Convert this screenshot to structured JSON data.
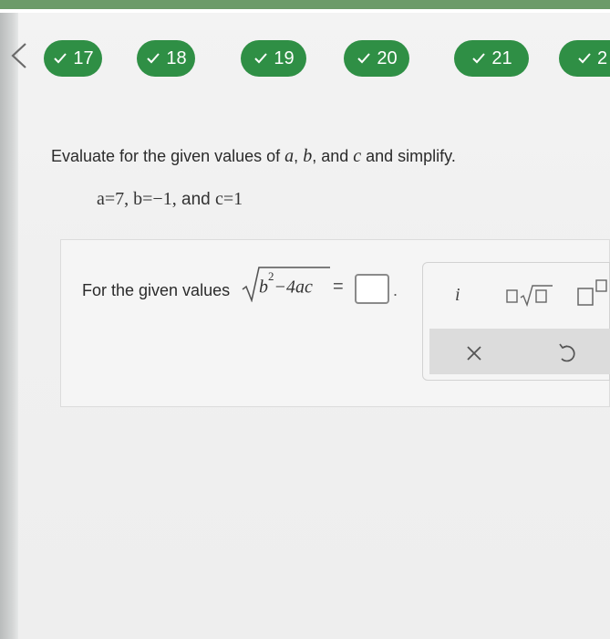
{
  "navigation": {
    "questions": [
      {
        "number": "17",
        "status": "correct"
      },
      {
        "number": "18",
        "status": "correct"
      },
      {
        "number": "19",
        "status": "correct"
      },
      {
        "number": "20",
        "status": "correct"
      },
      {
        "number": "21",
        "status": "correct"
      },
      {
        "number": "2",
        "status": "correct"
      }
    ]
  },
  "question": {
    "instruction_before": "Evaluate for the given values of ",
    "var_a": "a",
    "comma1": ", ",
    "var_b": "b",
    "comma_and": ", and ",
    "var_c": "c",
    "instruction_after": " and simplify.",
    "values_ab": "a=7, b=−1,",
    "values_and": " and ",
    "values_c": "c=1"
  },
  "answer": {
    "prompt": "For the given values",
    "radicand_b": "b",
    "radicand_exp": "2",
    "radicand_rest": "−4ac",
    "equals": "=",
    "value": "",
    "period": "."
  },
  "palette": {
    "imaginary_label": "i"
  },
  "colors": {
    "pill_green": "#2f8f45",
    "top_bar": "#6c9b69"
  }
}
